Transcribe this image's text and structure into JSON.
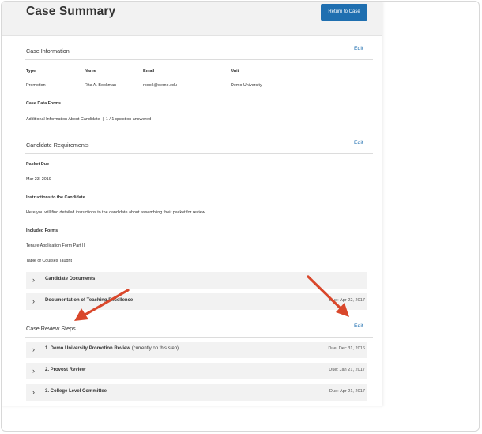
{
  "header": {
    "title": "Case Summary",
    "return_button": "Return to Case"
  },
  "case_information": {
    "title": "Case Information",
    "edit": "Edit",
    "columns": [
      "Type",
      "Name",
      "Email",
      "Unit"
    ],
    "values": [
      "Promotion",
      "Rita A. Bookman",
      "rbook@demo.edu",
      "Demo University"
    ],
    "data_forms_label": "Case Data Forms",
    "data_forms_value": "Additional Information About Candidate  |  1 / 1 question answered"
  },
  "candidate_requirements": {
    "title": "Candidate Requirements",
    "edit": "Edit",
    "packet_due_label": "Packet Due",
    "packet_due_value": "Mar 23, 2019",
    "instructions_label": "Instructions to the Candidate",
    "instructions_value": "Here you will find detailed insructions to the candidate about assembling their packet for review.",
    "included_forms_label": "Included Forms",
    "included_forms": [
      "Tenure Application Form Part II",
      "Table of Courses Taught"
    ],
    "accordions": [
      {
        "title": "Candidate Documents",
        "due": ""
      },
      {
        "title": "Documentation of Teaching Excellence",
        "due": "Due: Apr 22, 2017"
      }
    ]
  },
  "case_review_steps": {
    "title": "Case Review Steps",
    "edit": "Edit",
    "steps": [
      {
        "title": "1. Demo University Promotion Review",
        "note": "(currently on this step)",
        "due": "Due: Dec 31, 2016"
      },
      {
        "title": "2. Provost Review",
        "note": "",
        "due": "Due: Jan 21, 2017"
      },
      {
        "title": "3. College Level Committee",
        "note": "",
        "due": "Due: Apr 21, 2017"
      }
    ]
  },
  "icons": {
    "chevron": "›",
    "chevron_name": "chevron-right-icon"
  },
  "colors": {
    "accent": "#1f6fb0",
    "annotation_arrow": "#d9472b",
    "panel": "#f2f2f2"
  }
}
